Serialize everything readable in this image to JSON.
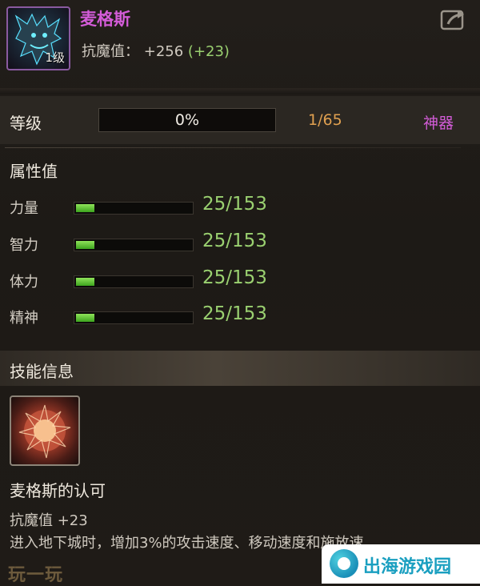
{
  "item": {
    "name": "麦格斯",
    "level_badge": "1级",
    "stat_label": "抗魔值：",
    "stat_value": "+256",
    "stat_bonus": "(+23)",
    "icon": "dragon-icon",
    "share_icon": "share-icon",
    "name_color": "#d35cd8"
  },
  "level": {
    "label": "等级",
    "progress_text": "0%",
    "progress_fraction": 0.0,
    "count": "1/65",
    "grade": "神器"
  },
  "attributes": {
    "title": "属性值",
    "items": [
      {
        "label": "力量",
        "value": "25/153",
        "fraction": 0.163
      },
      {
        "label": "智力",
        "value": "25/153",
        "fraction": 0.163
      },
      {
        "label": "体力",
        "value": "25/153",
        "fraction": 0.163
      },
      {
        "label": "精神",
        "value": "25/153",
        "fraction": 0.163
      }
    ]
  },
  "skill": {
    "section_title": "技能信息",
    "name": "麦格斯的认可",
    "stat": "抗魔值 +23",
    "description": "进入地下城时，增加3%的攻击速度、移动速度和施放速",
    "icon": "burst-orb-icon"
  },
  "watermarks": {
    "left": "玩一玩",
    "right": "出海游戏园"
  }
}
